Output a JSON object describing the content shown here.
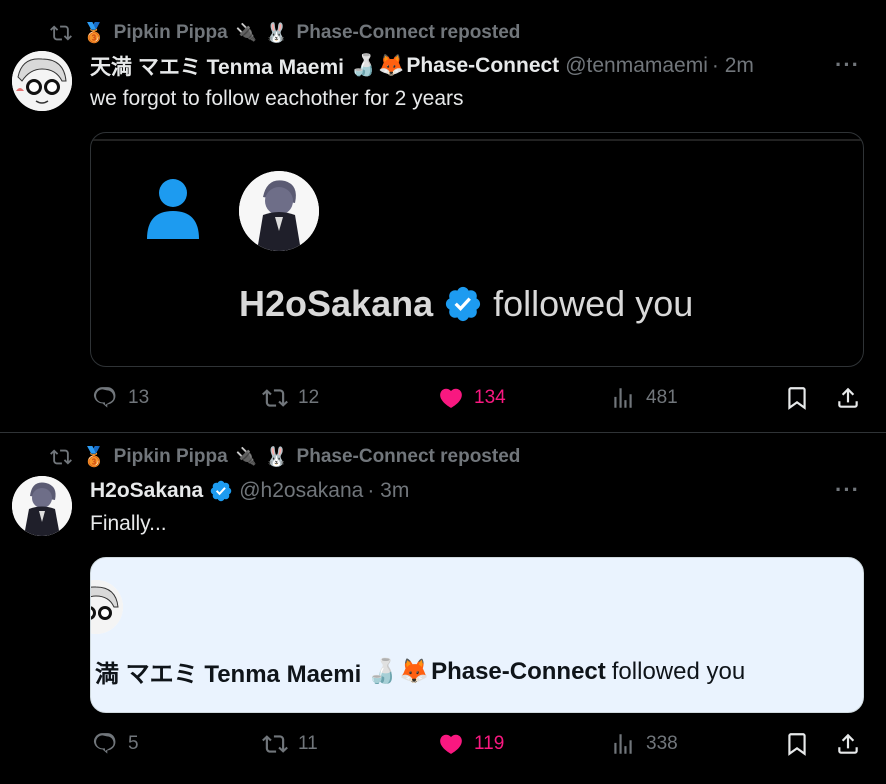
{
  "tweets": [
    {
      "repost": {
        "name": "Pipkin Pippa",
        "suffix": "Phase-Connect reposted"
      },
      "author": {
        "display": "天満 マエミ Tenma Maemi",
        "org": "Phase-Connect",
        "handle": "@tenmamaemi",
        "time": "· 2m"
      },
      "text": "we forgot to follow eachother for 2 years",
      "media": {
        "name": "H2oSakana",
        "action": "followed you"
      },
      "stats": {
        "replies": "13",
        "reposts": "12",
        "likes": "134",
        "views": "481"
      }
    },
    {
      "repost": {
        "name": "Pipkin Pippa",
        "suffix": "Phase-Connect reposted"
      },
      "author": {
        "display": "H2oSakana",
        "handle": "@h2osakana",
        "time": "· 3m"
      },
      "text": "Finally...",
      "media": {
        "name_part": "満 マエミ Tenma Maemi",
        "org": "Phase-Connect",
        "action": "followed you"
      },
      "stats": {
        "replies": "5",
        "reposts": "11",
        "likes": "119",
        "views": "338"
      }
    }
  ],
  "colors": {
    "background": "#000000",
    "text": "#e7e9ea",
    "muted": "#71767b",
    "like": "#f91880",
    "verified": "#1d9bf0"
  },
  "icons": [
    "repost-icon",
    "medal-icon",
    "plug-icon",
    "bunny-icon",
    "sake-icon",
    "fox-icon",
    "more-icon",
    "reply-icon",
    "like-icon",
    "views-icon",
    "bookmark-icon",
    "share-icon",
    "verified-badge-icon",
    "person-icon"
  ]
}
